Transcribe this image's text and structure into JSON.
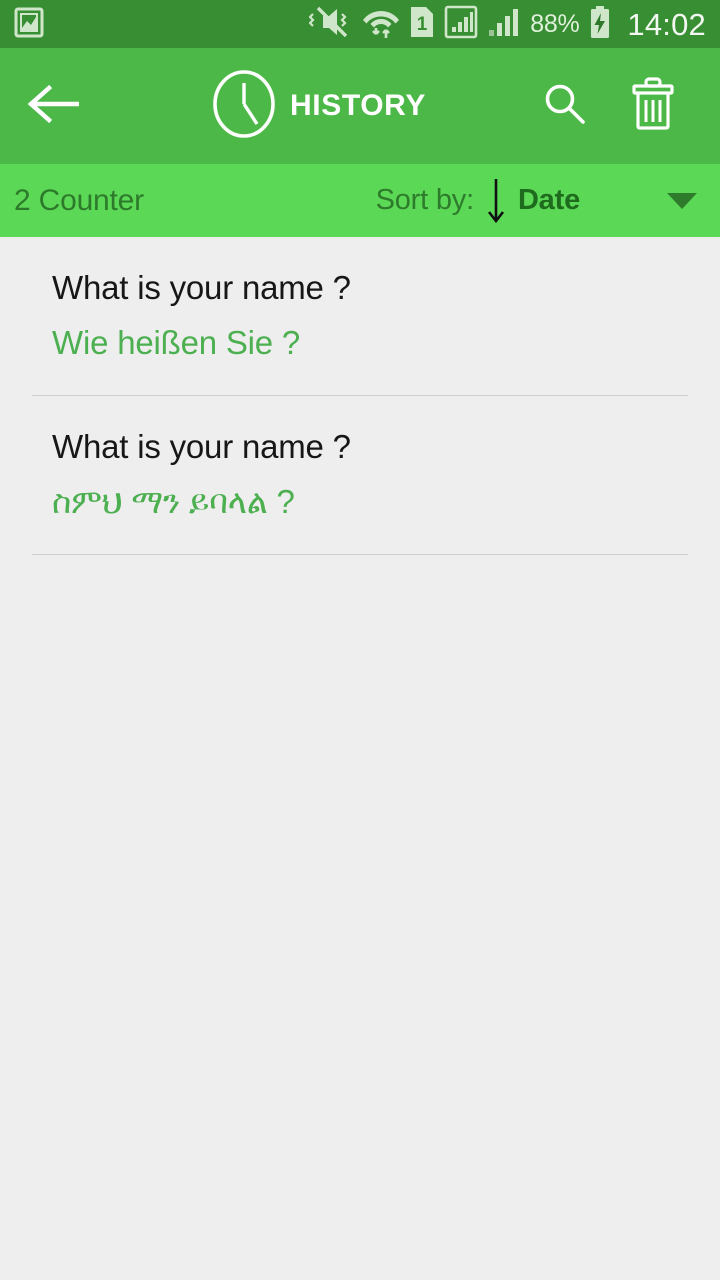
{
  "status_bar": {
    "background": "#388e32",
    "notification_icon": "image-notification-icon",
    "icons": [
      "mute-vibrate-icon",
      "wifi-icon",
      "sim-1-icon",
      "signal-bars-sim1-icon",
      "signal-bars-sim2-icon"
    ],
    "sim_label": "1",
    "battery_percent": "88%",
    "battery_state": "charging",
    "clock": "14:02"
  },
  "app_bar": {
    "background": "#4cb848",
    "back_icon": "back-arrow-icon",
    "title_icon": "clock-icon",
    "title": "HISTORY",
    "search_icon": "search-icon",
    "delete_icon": "trash-icon"
  },
  "sort_bar": {
    "background": "#5bd855",
    "counter": "2 Counter",
    "sort_label": "Sort by:",
    "sort_direction_icon": "arrow-down-icon",
    "sort_value": "Date",
    "dropdown_icon": "chevron-down-icon"
  },
  "history": {
    "items": [
      {
        "source": "What is your name ?",
        "translation": "Wie heißen Sie ?"
      },
      {
        "source": "What is your name ?",
        "translation": "ስምህ ማን ይባላል ?"
      }
    ]
  },
  "colors": {
    "status_bar_green": "#388e32",
    "app_bar_green": "#4cb848",
    "sort_bar_green": "#5bd855",
    "translation_green": "#4caf50",
    "list_background": "#eeeeee",
    "source_text": "#171717"
  }
}
